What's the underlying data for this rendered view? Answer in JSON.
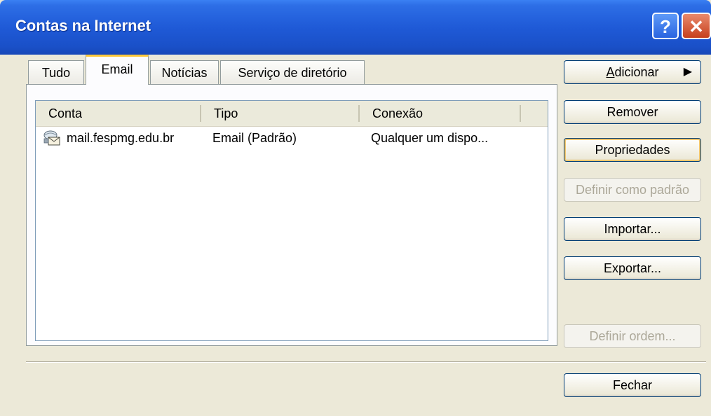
{
  "window": {
    "title": "Contas na Internet",
    "help_glyph": "?",
    "close_glyph": "✕"
  },
  "tabs": [
    {
      "label": "Tudo"
    },
    {
      "label": "Email",
      "active": true
    },
    {
      "label": "Notícias"
    },
    {
      "label": "Serviço de diretório"
    }
  ],
  "list": {
    "columns": [
      "Conta",
      "Tipo",
      "Conexão"
    ],
    "rows": [
      {
        "icon": "mail-account-icon",
        "conta": "mail.fespmg.edu.br",
        "tipo": "Email (Padrão)",
        "conexao": "Qualquer um dispo..."
      }
    ]
  },
  "buttons": {
    "adicionar_first": "A",
    "adicionar_rest": "dicionar",
    "adicionar_arrow": "▶",
    "remover": "Remover",
    "propriedades": "Propriedades",
    "definir_padrao": "Definir como padrão",
    "importar": "Importar...",
    "exportar": "Exportar...",
    "definir_ordem": "Definir ordem...",
    "fechar": "Fechar"
  },
  "colors": {
    "titlebar": "#1f5ad7",
    "dialog_bg": "#ece9d8",
    "tab_highlight": "#ffc83c",
    "button_border": "#003c74"
  }
}
